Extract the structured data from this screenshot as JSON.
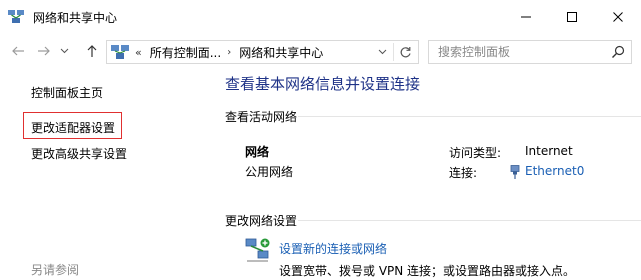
{
  "window": {
    "title": "网络和共享中心"
  },
  "address_bar": {
    "overflow": "«",
    "crumbs": [
      "所有控制面...",
      "网络和共享中心"
    ],
    "arrow": "›"
  },
  "search": {
    "placeholder": "搜索控制面板"
  },
  "left_pane": {
    "home": "控制面板主页",
    "change_adapter": "更改适配器设置",
    "change_advanced": "更改高级共享设置",
    "see_also": "另请参阅"
  },
  "main": {
    "title": "查看基本网络信息并设置连接",
    "active_networks_heading": "查看活动网络",
    "network": {
      "name": "网络",
      "type": "公用网络",
      "access_type_label": "访问类型:",
      "access_type_value": "Internet",
      "connections_label": "连接:",
      "connections_value": "Ethernet0"
    },
    "change_settings_heading": "更改网络设置",
    "tasks": [
      {
        "link": "设置新的连接或网络",
        "description": "设置宽带、拨号或 VPN 连接；或设置路由器或接入点。"
      }
    ]
  },
  "colors": {
    "title_blue": "#1e3287",
    "link_blue": "#1a5fb4",
    "highlight_red": "#e03030"
  },
  "icons": {
    "app": "network-center-icon",
    "minimize": "minimize-icon",
    "maximize": "maximize-icon",
    "close": "close-icon",
    "back": "arrow-left-icon",
    "forward": "arrow-right-icon",
    "recent": "chevron-down-icon",
    "up": "arrow-up-icon",
    "refresh": "refresh-icon",
    "search": "search-icon",
    "ethernet": "ethernet-icon",
    "new_connection": "new-connection-icon"
  }
}
